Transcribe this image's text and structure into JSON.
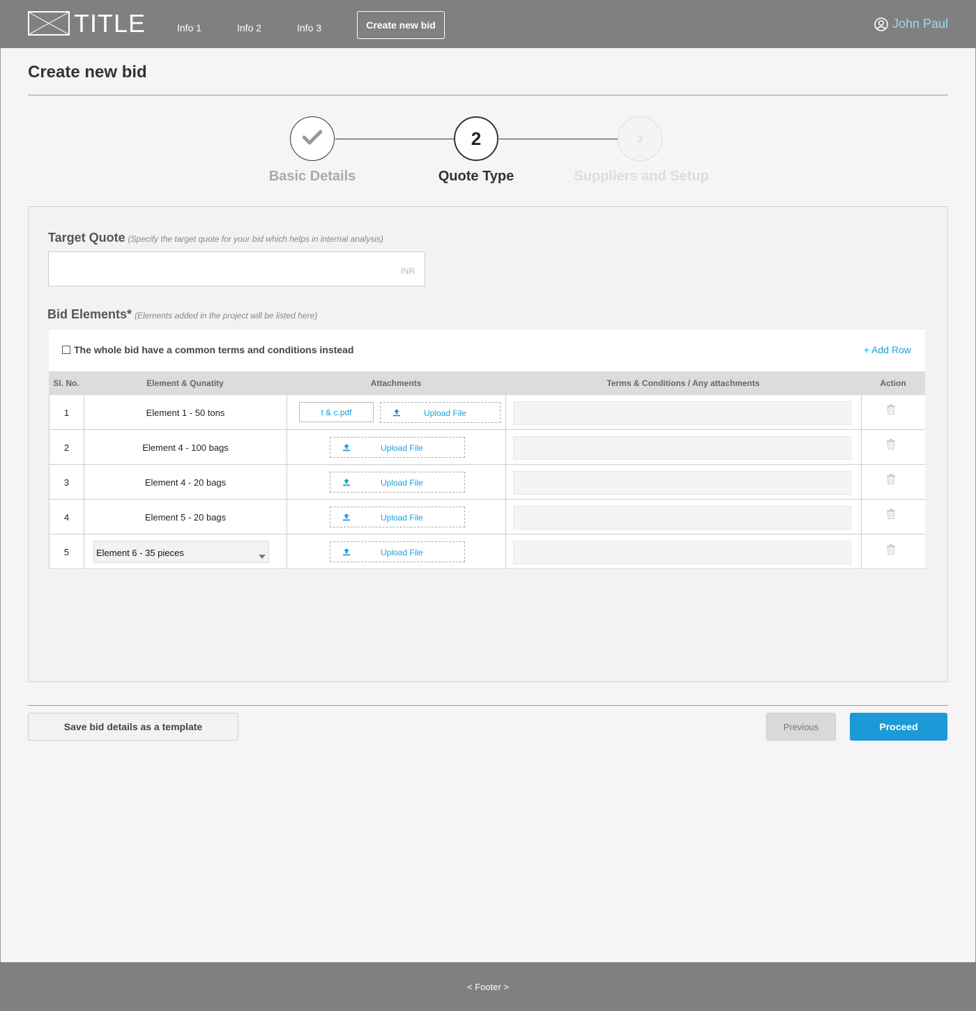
{
  "header": {
    "logo_title": "TITLE",
    "nav": [
      "Info 1",
      "Info 2",
      "Info 3"
    ],
    "create_button": "Create new bid",
    "user_name": "John Paul"
  },
  "page": {
    "title": "Create new bid"
  },
  "stepper": {
    "steps": [
      {
        "number": "",
        "label": "Basic Details",
        "state": "done",
        "icon": "check-icon"
      },
      {
        "number": "2",
        "label": "Quote Type",
        "state": "active"
      },
      {
        "number": "3",
        "label": "Suppliers and Setup",
        "state": "pending"
      }
    ]
  },
  "target_quote": {
    "title": "Target Quote",
    "hint": "(Specify the target quote for your bid which helps in internal analysis)",
    "value": "",
    "suffix": "INR"
  },
  "bid_elements": {
    "title": "Bid Elements*",
    "hint": "(Elements added in the project will be listed here)",
    "common_terms_label": "The whole bid have a common terms and conditions instead",
    "common_terms_checked": false,
    "add_row": "+ Add Row",
    "columns": [
      "Sl. No.",
      "Element & Qunatity",
      "Attachments",
      "Terms & Conditions / Any attachments",
      "Action"
    ],
    "rows": [
      {
        "no": "1",
        "element": "Element 1 - 50 tons",
        "file": "t & c.pdf",
        "upload": "Upload File"
      },
      {
        "no": "2",
        "element": "Element 4 - 100 bags",
        "upload": "Upload File"
      },
      {
        "no": "3",
        "element": "Element 4 - 20 bags",
        "upload": "Upload File"
      },
      {
        "no": "4",
        "element": "Element 5 - 20 bags",
        "upload": "Upload File"
      },
      {
        "no": "5",
        "element_select": "Element 6 - 35 pieces",
        "upload": "Upload File"
      }
    ]
  },
  "actions": {
    "save_template": "Save bid details as a template",
    "previous": "Previous",
    "proceed": "Proceed"
  },
  "footer": {
    "text": "< Footer >"
  },
  "colors": {
    "header_bg": "#808080",
    "accent": "#1a9ad6",
    "link": "#1aa0d8",
    "user": "#9fd8ee"
  }
}
